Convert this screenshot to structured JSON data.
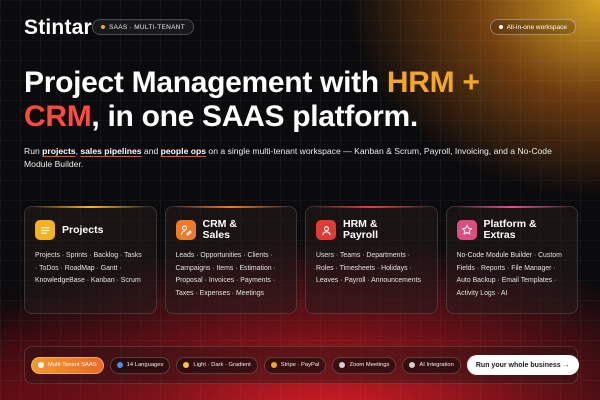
{
  "header": {
    "logo_text": "Stintar",
    "badge_label": "SAAS · MULTI-TENANT",
    "right_badge_label": "All-in-one workspace"
  },
  "headline": {
    "part1": "Project Management with ",
    "accent1": "HRM +",
    "line2_accent": "CRM",
    "part2": ", in one SAAS platform."
  },
  "subtext": {
    "lead": "Run ",
    "hl1": "projects",
    "sep1": ", ",
    "hl2": "sales pipelines",
    "mid": " and ",
    "hl3": "people ops",
    "tail": " on a single multi-tenant workspace — Kanban & Scrum, Payroll, Invoicing, and a No-Code Module Builder."
  },
  "cards": [
    {
      "title": "Projects",
      "icon": "list-icon",
      "body": "Projects · Sprints · Backlog · Tasks · ToDos · RoadMap · Gantt · KnowledgeBase · Kanban · Scrum"
    },
    {
      "title_line1": "CRM &",
      "title_line2": "Sales",
      "icon": "user-pen-icon",
      "body": "Leads · Opportunities · Clients · Campaigns · Items · Estimation · Proposal · Invoices · Payments · Taxes · Expenses · Meetings"
    },
    {
      "title_line1": "HRM &",
      "title_line2": "Payroll",
      "icon": "person-icon",
      "body": "Users · Teams · Departments · Roles · Timesheets · Holidays · Leaves · Payroll · Announcements"
    },
    {
      "title_line1": "Platform &",
      "title_line2": "Extras",
      "icon": "star-icon",
      "body": "No-Code Module Builder · Custom Fields · Reports · File Manager · Auto Backup · Email Templates · Activity Logs · AI"
    }
  ],
  "chips": [
    {
      "label": "Multi-Tenant SAAS",
      "dot_color": "#ffffff"
    },
    {
      "label": "14 Languages",
      "dot_color": "#4a8cf0"
    },
    {
      "label": "Light · Dark · Gradient",
      "dot_color": "#f5c542"
    },
    {
      "label": "Stripe · PayPal",
      "dot_color": "#f5a623"
    },
    {
      "label": "Zoom Meetings",
      "dot_color": "#cfcfcf"
    },
    {
      "label": "AI Integration",
      "dot_color": "#cfcfcf"
    }
  ],
  "cta": {
    "label": "Run your whole business →"
  },
  "colors": {
    "accent_orange": "#f5a623",
    "accent_red": "#ff4a3d"
  }
}
